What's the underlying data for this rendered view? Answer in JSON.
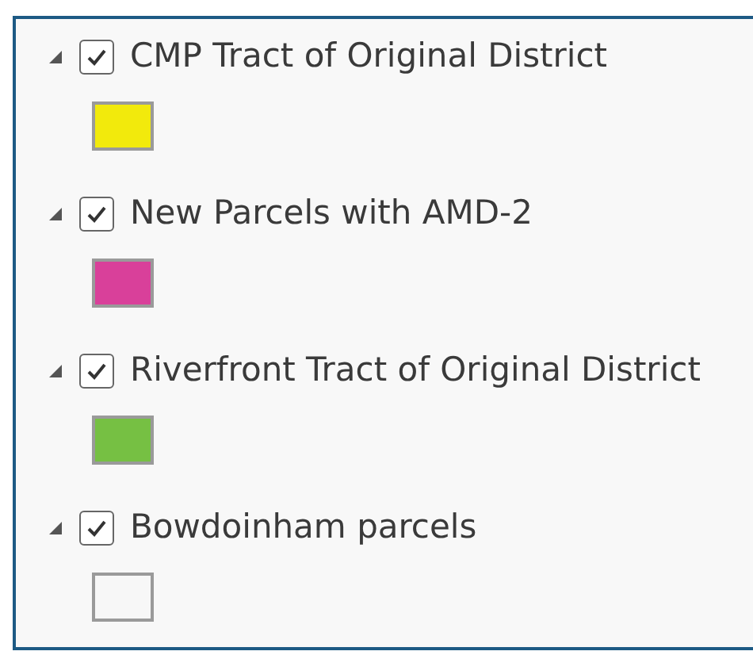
{
  "layers": [
    {
      "name": "CMP Tract of Original District",
      "expanded": true,
      "checked": true,
      "color": "#f2ea0c"
    },
    {
      "name": "New Parcels with AMD-2",
      "expanded": true,
      "checked": true,
      "color": "#d9409a"
    },
    {
      "name": "Riverfront Tract of Original District",
      "expanded": true,
      "checked": true,
      "color": "#76c043"
    },
    {
      "name": "Bowdoinham parcels",
      "expanded": true,
      "checked": true,
      "color": "#f7f7f7"
    }
  ]
}
